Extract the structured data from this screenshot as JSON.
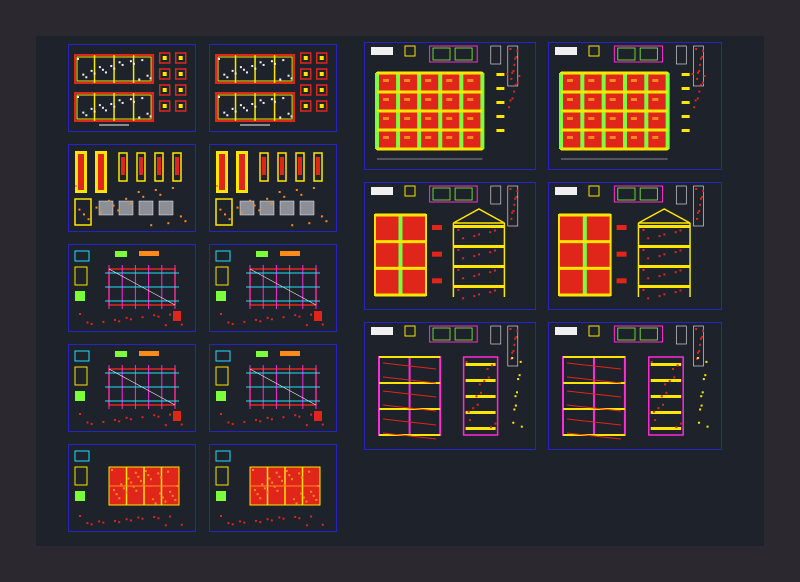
{
  "viewport": {
    "background": "#2b2830",
    "drawing_area_color": "#1e222a",
    "sheet_border_color": "#2424c8"
  },
  "palette": {
    "red": "#e0261b",
    "yellow": "#ffe600",
    "green": "#7cff3a",
    "magenta": "#ff2bd6",
    "cyan": "#20e0ff",
    "white": "#f0f0f0",
    "orange": "#ff8a1c",
    "blue": "#2424c8"
  },
  "sheets": [
    {
      "id": "sheet-left-1a",
      "kind": "plan-strip"
    },
    {
      "id": "sheet-left-1b",
      "kind": "plan-strip"
    },
    {
      "id": "sheet-left-2a",
      "kind": "details"
    },
    {
      "id": "sheet-left-2b",
      "kind": "details"
    },
    {
      "id": "sheet-left-3a",
      "kind": "framing-plan"
    },
    {
      "id": "sheet-left-3b",
      "kind": "framing-plan"
    },
    {
      "id": "sheet-left-4a",
      "kind": "framing-plan"
    },
    {
      "id": "sheet-left-4b",
      "kind": "framing-plan"
    },
    {
      "id": "sheet-left-5a",
      "kind": "slab-plan"
    },
    {
      "id": "sheet-left-5b",
      "kind": "slab-plan"
    },
    {
      "id": "sheet-right-1a",
      "kind": "elevation-grid"
    },
    {
      "id": "sheet-right-1b",
      "kind": "elevation-grid"
    },
    {
      "id": "sheet-right-2a",
      "kind": "section"
    },
    {
      "id": "sheet-right-2b",
      "kind": "section"
    },
    {
      "id": "sheet-right-3a",
      "kind": "stair"
    },
    {
      "id": "sheet-right-3b",
      "kind": "stair"
    }
  ]
}
